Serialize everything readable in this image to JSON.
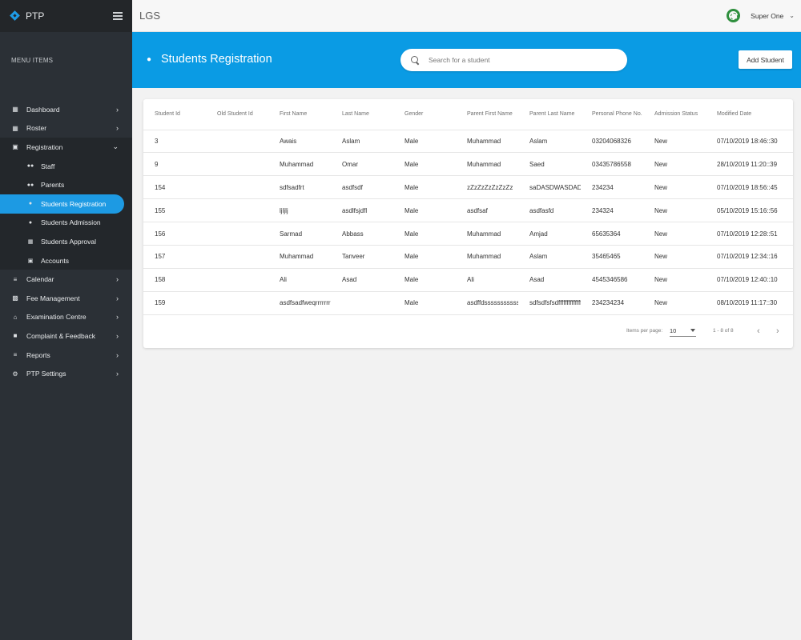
{
  "brand": "PTP",
  "app_title": "LGS",
  "user": {
    "name": "Super One"
  },
  "sidebar": {
    "section_label": "MENU ITEMS",
    "items": [
      {
        "label": "Dashboard",
        "icon": "dashboard-icon"
      },
      {
        "label": "Roster",
        "icon": "table-icon"
      },
      {
        "label": "Registration",
        "icon": "id-card-icon",
        "open": true
      },
      {
        "label": "Calendar",
        "icon": "lines-icon"
      },
      {
        "label": "Fee Management",
        "icon": "printer-icon"
      },
      {
        "label": "Examination Centre",
        "icon": "building-icon"
      },
      {
        "label": "Complaint & Feedback",
        "icon": "feedback-icon"
      },
      {
        "label": "Reports",
        "icon": "list-icon"
      },
      {
        "label": "PTP Settings",
        "icon": "gear-icon"
      }
    ],
    "sub_items": [
      {
        "label": "Staff",
        "icon": "people-icon"
      },
      {
        "label": "Parents",
        "icon": "people-icon"
      },
      {
        "label": "Students Registration",
        "icon": "person-icon",
        "active": true
      },
      {
        "label": "Students Admission",
        "icon": "person-icon"
      },
      {
        "label": "Students Approval",
        "icon": "table-icon"
      },
      {
        "label": "Accounts",
        "icon": "id-card-icon"
      }
    ]
  },
  "banner": {
    "title": "Students Registration",
    "search_placeholder": "Search for a student",
    "add_button": "Add Student",
    "color": "#0a9be4"
  },
  "table": {
    "headers": [
      "Student Id",
      "Old Student Id",
      "First Name",
      "Last Name",
      "Gender",
      "Parent First Name",
      "Parent Last Name",
      "Personal Phone No.",
      "Admission Status",
      "Modified Date"
    ],
    "rows": [
      [
        "3",
        "",
        "Awais",
        "Aslam",
        "Male",
        "Muhammad",
        "Aslam",
        "03204068326",
        "New",
        "07/10/2019 18:46::30"
      ],
      [
        "9",
        "",
        "Muhammad",
        "Omar",
        "Male",
        "Muhammad",
        "Saed",
        "03435786558",
        "New",
        "28/10/2019 11:20::39"
      ],
      [
        "154",
        "",
        "sdfsadfrt",
        "asdfsdf",
        "Male",
        "zZzZzZzZzZzZz",
        "saDASDWASDADAD",
        "234234",
        "New",
        "07/10/2019 18:56::45"
      ],
      [
        "155",
        "",
        "ljljlj",
        "asdlfsjdfl",
        "Male",
        "asdfsaf",
        "asdfasfd",
        "234324",
        "New",
        "05/10/2019 15:16::56"
      ],
      [
        "156",
        "",
        "Sarmad",
        "Abbass",
        "Male",
        "Muhammad",
        "Amjad",
        "65635364",
        "New",
        "07/10/2019 12:28::51"
      ],
      [
        "157",
        "",
        "Muhammad",
        "Tanveer",
        "Male",
        "Muhammad",
        "Aslam",
        "35465465",
        "New",
        "07/10/2019 12:34::16"
      ],
      [
        "158",
        "",
        "Ali",
        "Asad",
        "Male",
        "Ali",
        "Asad",
        "4545346586",
        "New",
        "07/10/2019 12:40::10"
      ],
      [
        "159",
        "",
        "asdfsadfweqrrrrrrrrrsadfsadfsdfaaaaaaa",
        "",
        "Male",
        "asdffdssssssssssssss",
        "sdfsdfsfsdfffffffffffffff",
        "234234234",
        "New",
        "08/10/2019 11:17::30"
      ]
    ]
  },
  "pager": {
    "items_per_page_label": "Items per page:",
    "items_per_page_value": "10",
    "range": "1 - 8 of 8"
  }
}
